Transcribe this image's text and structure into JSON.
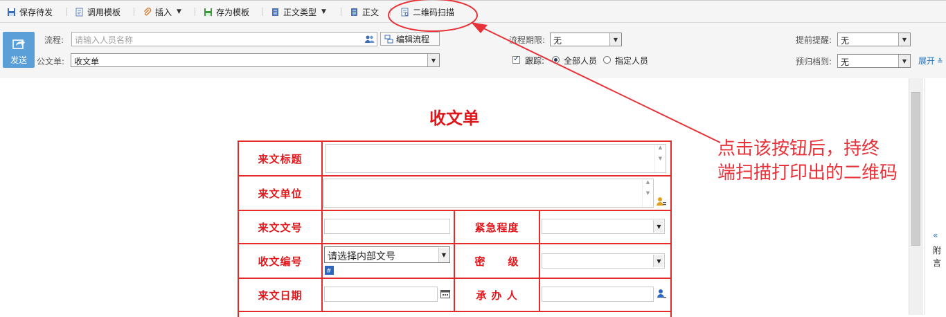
{
  "toolbar": {
    "items": [
      {
        "label": "保存待发"
      },
      {
        "label": "调用模板"
      },
      {
        "label": "插入"
      },
      {
        "label": "存为模板"
      },
      {
        "label": "正文类型"
      },
      {
        "label": "正文"
      },
      {
        "label": "二维码扫描"
      }
    ]
  },
  "form": {
    "send_label": "发送",
    "process_label": "流程:",
    "process_placeholder": "请输入人员名称",
    "edit_process_label": "编辑流程",
    "doc_form_label": "公文单:",
    "doc_form_value": "收文单",
    "deadline_label": "流程期限:",
    "deadline_value": "无",
    "remind_label": "提前提醒:",
    "remind_value": "无",
    "track_label": "跟踪:",
    "track_options": [
      "全部人员",
      "指定人员"
    ],
    "archive_label": "预归档到:",
    "archive_value": "无",
    "expand_label": "展开"
  },
  "document": {
    "title": "收文单",
    "rows": {
      "subject_label": "来文标题",
      "unit_label": "来文单位",
      "doc_no_label": "来文文号",
      "urgency_label": "紧急程度",
      "serial_label": "收文编号",
      "serial_placeholder": "请选择内部文号",
      "secret_label": "密　　级",
      "date_label": "来文日期",
      "handler_label": "承 办 人"
    }
  },
  "side_panel": {
    "label_1": "附",
    "label_2": "言"
  },
  "annotation": {
    "text_line1": "点击该按钮后，持终",
    "text_line2": "端扫描打印出的二维码"
  },
  "colors": {
    "accent": "#e0161b",
    "send_button": "#5b9fd9",
    "link": "#1f6fb5"
  }
}
